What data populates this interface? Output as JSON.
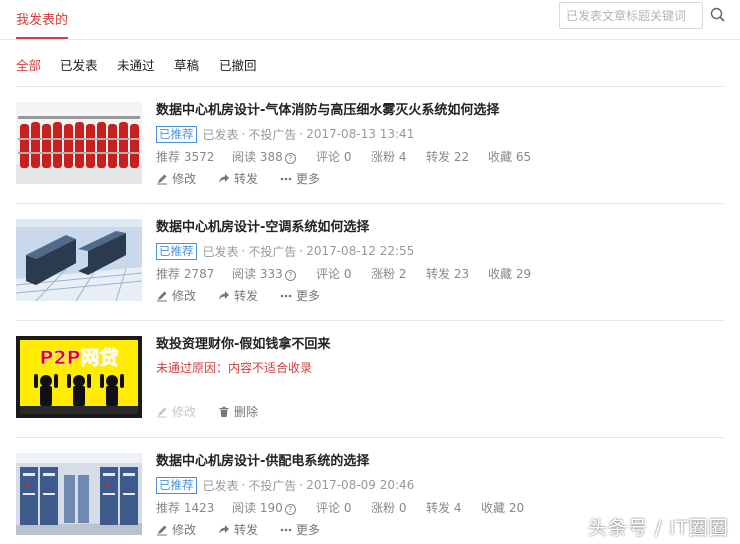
{
  "header": {
    "tab_title": "我发表的",
    "search_placeholder": "已发表文章标题关键词"
  },
  "filters": [
    "全部",
    "已发表",
    "未通过",
    "草稿",
    "已撤回"
  ],
  "active_filter_index": 0,
  "articles": [
    {
      "title": "数据中心机房设计-气体消防与高压细水雾灭火系统如何选择",
      "badge": "已推荐",
      "status": "已发表",
      "dot": "·",
      "ad": "不投广告",
      "date": "2017-08-13 13:41",
      "stats": {
        "recommend": "推荐 3572",
        "read": "阅读 388",
        "comment": "评论 0",
        "fans": "涨粉 4",
        "share": "转发 22",
        "fav": "收藏 65"
      },
      "actions": {
        "edit": "修改",
        "share": "转发",
        "more": "更多"
      }
    },
    {
      "title": "数据中心机房设计-空调系统如何选择",
      "badge": "已推荐",
      "status": "已发表",
      "dot": "·",
      "ad": "不投广告",
      "date": "2017-08-12 22:55",
      "stats": {
        "recommend": "推荐 2787",
        "read": "阅读 333",
        "comment": "评论 0",
        "fans": "涨粉 2",
        "share": "转发 23",
        "fav": "收藏 29"
      },
      "actions": {
        "edit": "修改",
        "share": "转发",
        "more": "更多"
      }
    },
    {
      "title": "致投资理财你-假如钱拿不回来",
      "reject_reason": "未通过原因：内容不适合收录",
      "thumb_text": "P2P网贷",
      "actions": {
        "edit": "修改",
        "delete": "删除"
      }
    },
    {
      "title": "数据中心机房设计-供配电系统的选择",
      "badge": "已推荐",
      "status": "已发表",
      "dot": "·",
      "ad": "不投广告",
      "date": "2017-08-09 20:46",
      "stats": {
        "recommend": "推荐 1423",
        "read": "阅读 190",
        "comment": "评论 0",
        "fans": "涨粉 0",
        "share": "转发 4",
        "fav": "收藏 20"
      },
      "actions": {
        "edit": "修改",
        "share": "转发",
        "more": "更多"
      }
    }
  ],
  "watermark": "头条号 / IT圈圈",
  "colors": {
    "accent": "#d43d3d",
    "badge": "#4a90d9",
    "meta": "#999999"
  },
  "icons": {
    "search": "search-icon",
    "edit": "pencil-icon",
    "share": "share-arrow-icon",
    "more": "ellipsis-icon",
    "delete": "trash-icon",
    "help": "question-circle-icon"
  }
}
